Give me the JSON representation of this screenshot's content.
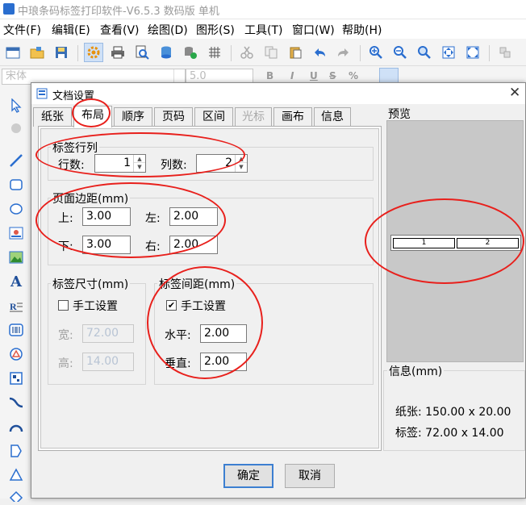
{
  "app": {
    "title": "中琅条码标签打印软件-V6.5.3 数码版 单机",
    "menu": [
      "文件(F)",
      "编辑(E)",
      "查看(V)",
      "绘图(D)",
      "图形(S)",
      "工具(T)",
      "窗口(W)",
      "帮助(H)"
    ],
    "font_name": "宋体",
    "font_size": "5.0",
    "text_format": [
      "B",
      "I",
      "U",
      "S",
      "%"
    ]
  },
  "dialog": {
    "title": "文档设置",
    "close": "✕",
    "tabs": [
      {
        "label": "纸张",
        "state": "normal"
      },
      {
        "label": "布局",
        "state": "active"
      },
      {
        "label": "顺序",
        "state": "normal"
      },
      {
        "label": "页码",
        "state": "normal"
      },
      {
        "label": "区间",
        "state": "normal"
      },
      {
        "label": "光标",
        "state": "disabled"
      },
      {
        "label": "画布",
        "state": "normal"
      },
      {
        "label": "信息",
        "state": "normal"
      }
    ],
    "rows_cols": {
      "group_title": "标签行列",
      "rows_label": "行数:",
      "rows_value": "1",
      "cols_label": "列数:",
      "cols_value": "2"
    },
    "margins": {
      "group_title": "页面边距(mm)",
      "top_label": "上:",
      "top_value": "3.00",
      "left_label": "左:",
      "left_value": "2.00",
      "bottom_label": "下:",
      "bottom_value": "3.00",
      "right_label": "右:",
      "right_value": "2.00"
    },
    "label_size": {
      "group_title": "标签尺寸(mm)",
      "manual_label": "手工设置",
      "manual_checked": false,
      "width_label": "宽:",
      "width_value": "72.00",
      "height_label": "高:",
      "height_value": "14.00"
    },
    "label_gap": {
      "group_title": "标签间距(mm)",
      "manual_label": "手工设置",
      "manual_checked": true,
      "check_mark": "✔",
      "horizontal_label": "水平:",
      "horizontal_value": "2.00",
      "vertical_label": "垂直:",
      "vertical_value": "2.00"
    },
    "preview": {
      "title": "预览",
      "cells": [
        "1",
        "2"
      ]
    },
    "info": {
      "title": "信息(mm)",
      "paper": "纸张: 150.00 x 20.00",
      "label": "标签: 72.00 x 14.00"
    },
    "ok_label": "确定",
    "cancel_label": "取消"
  },
  "colors": {
    "annotation": "#e8201c",
    "active_tab_border": "#3c7fd1",
    "preview_bg": "#c8c8c8"
  }
}
